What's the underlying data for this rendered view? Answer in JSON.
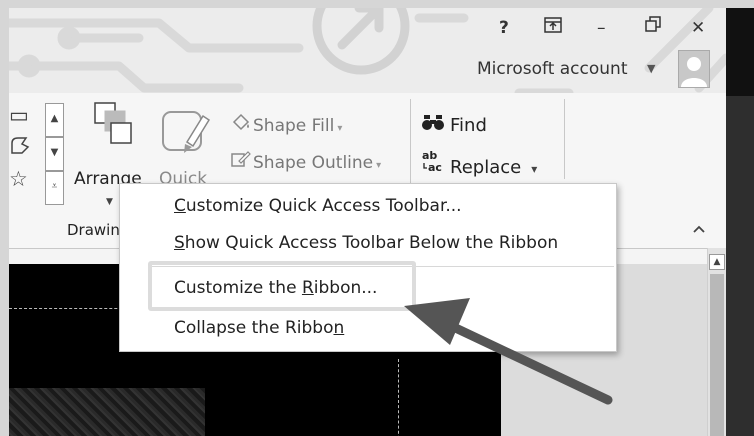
{
  "titlebar": {
    "help_icon": "?",
    "ribbon_display_icon": "ribbon-display-options-icon",
    "minimize_icon": "–",
    "restore_icon": "🗗",
    "close_icon": "✕",
    "account_label": "Microsoft account",
    "account_caret": "▼"
  },
  "ribbon": {
    "arrange_label": "Arrange",
    "arrange_caret": "▼",
    "quick_styles_label": "Quick",
    "shape_fill_label": "Shape Fill",
    "shape_outline_label": "Shape Outline",
    "find_label": "Find",
    "replace_label": "Replace",
    "drawing_group_label": "Drawing",
    "caret": "▾",
    "collapse_chevron": "⌃"
  },
  "context_menu": {
    "items": [
      {
        "pre": "",
        "ul": "C",
        "post": "ustomize Quick Access Toolbar..."
      },
      {
        "pre": "",
        "ul": "S",
        "post": "how Quick Access Toolbar Below the Ribbon"
      },
      {
        "pre": "Customize the ",
        "ul": "R",
        "post": "ibbon..."
      },
      {
        "pre": "Collapse the Ribbo",
        "ul": "n",
        "post": ""
      }
    ]
  },
  "colors": {
    "annotation_arrow": "#555555",
    "highlight_border": "#dcdcdc",
    "canvas": "#000000"
  }
}
